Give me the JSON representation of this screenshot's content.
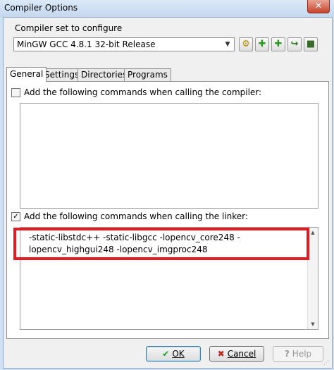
{
  "window": {
    "title": "Compiler Options",
    "close": "✕"
  },
  "compiler": {
    "label": "Compiler set to configure",
    "selected": "MinGW GCC 4.8.1 32-bit Release"
  },
  "toolbar": {
    "buttons": [
      {
        "icon": "find-compiler-icon",
        "glyph": "⚙",
        "color": "#b58a00"
      },
      {
        "icon": "add-empty-icon",
        "glyph": "✚",
        "color": "#2e9a25"
      },
      {
        "icon": "add-folder-icon",
        "glyph": "✚",
        "color": "#2e9a25"
      },
      {
        "icon": "rename-icon",
        "glyph": "↪",
        "color": "#2e7a25"
      },
      {
        "icon": "delete-icon",
        "glyph": "🗑",
        "color": "#3a6a2a"
      }
    ]
  },
  "tabs": [
    "General",
    "Settings",
    "Directories",
    "Programs"
  ],
  "general": {
    "compiler_cmd": {
      "checked": false,
      "label": "Add the following commands when calling the compiler:",
      "text": ""
    },
    "linker_cmd": {
      "checked": true,
      "label": "Add the following commands when calling the linker:",
      "text": "-static-libstdc++ -static-libgcc -lopencv_core248 -lopencv_highgui248 -lopencv_imgproc248"
    }
  },
  "buttons": {
    "ok": "OK",
    "cancel": "Cancel",
    "help": "Help"
  },
  "colors": {
    "highlight": "#e31b23",
    "ok_icon": "#1e9a1e",
    "cancel_icon": "#c0221a"
  }
}
